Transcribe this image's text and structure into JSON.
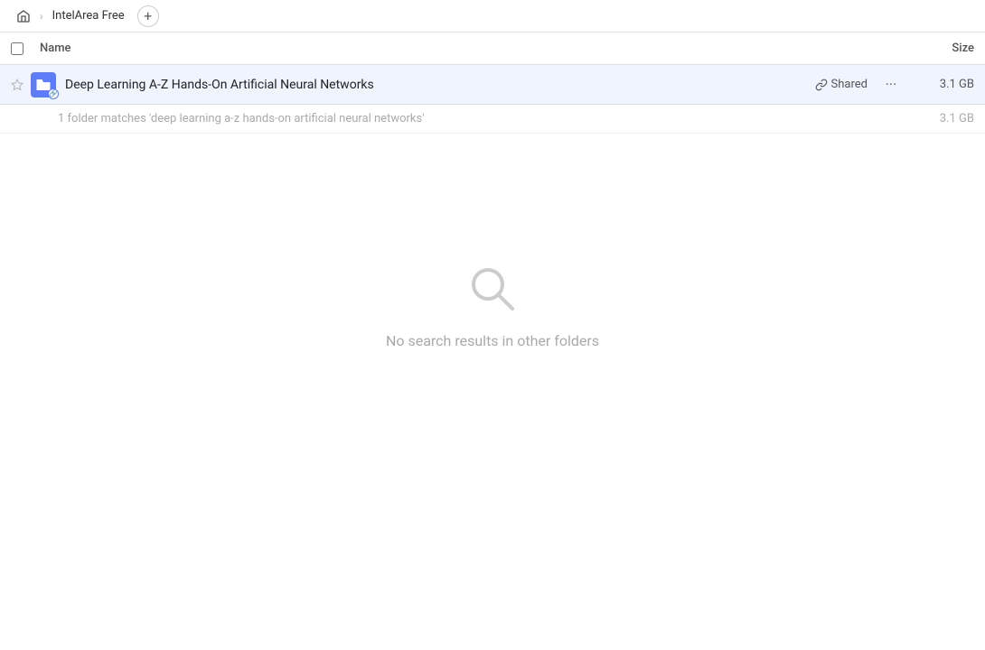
{
  "breadcrumb": {
    "home_label": "🏠",
    "separator": "›",
    "current": "IntelArea Free",
    "add_label": "+"
  },
  "table": {
    "col_name": "Name",
    "col_size": "Size"
  },
  "file_row": {
    "name": "Deep Learning A-Z Hands-On Artificial Neural Networks",
    "shared_label": "Shared",
    "more_label": "···",
    "size": "3.1 GB"
  },
  "summary": {
    "text": "1 folder matches 'deep learning a-z hands-on artificial neural networks'",
    "size": "3.1 GB"
  },
  "empty_state": {
    "text": "No search results in other folders"
  }
}
